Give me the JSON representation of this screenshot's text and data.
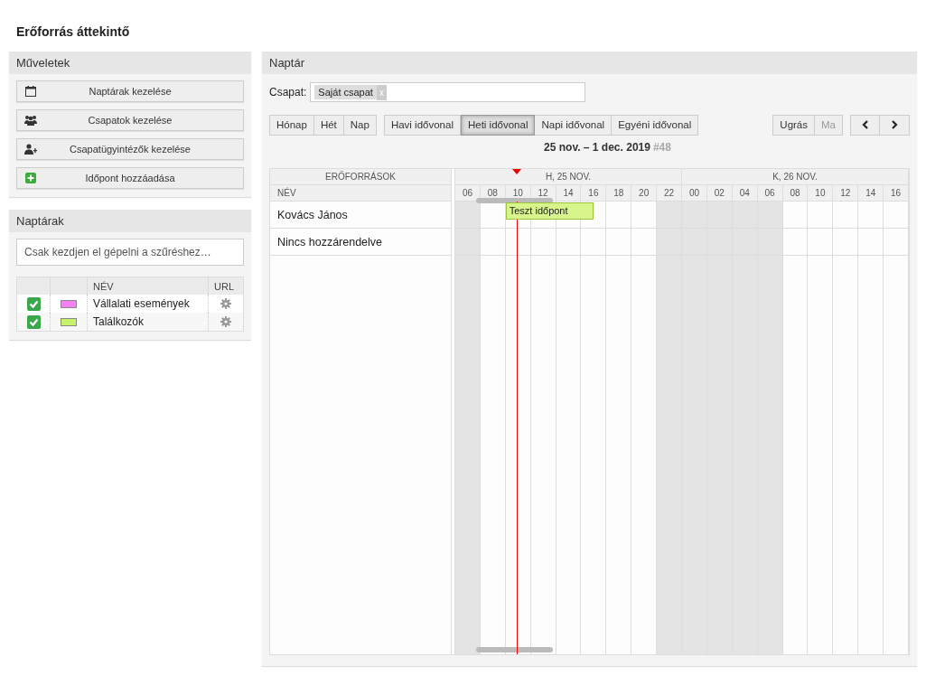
{
  "page_title": "Erőforrás áttekintő",
  "actions": {
    "title": "Műveletek",
    "buttons": [
      {
        "label": "Naptárak kezelése",
        "kind": "calendar"
      },
      {
        "label": "Csapatok kezelése",
        "kind": "group"
      },
      {
        "label": "Csapatügyintézők kezelése",
        "kind": "user-add"
      },
      {
        "label": "Időpont hozzáadása",
        "kind": "add"
      }
    ]
  },
  "calendars": {
    "title": "Naptárak",
    "filter": {
      "placeholder": "Csak kezdjen el gépelni a szűréshez…"
    },
    "columns": [
      "NÉV",
      "URL"
    ],
    "rows": [
      {
        "checked": true,
        "color": "#f380f0",
        "name": "Vállalati események"
      },
      {
        "checked": true,
        "color": "#c8f26b",
        "name": "Találkozók"
      }
    ]
  },
  "calendar": {
    "title": "Naptár",
    "team_label": "Csapat:",
    "team_tags": [
      {
        "label": "Saját csapat",
        "remove": "x"
      }
    ],
    "view_groups": [
      [
        {
          "label": "Hónap",
          "selected": false
        },
        {
          "label": "Hét",
          "selected": false
        },
        {
          "label": "Nap",
          "selected": false
        }
      ],
      [
        {
          "label": "Havi idővonal",
          "selected": false
        },
        {
          "label": "Heti idővonal",
          "selected": true
        },
        {
          "label": "Napi idővonal",
          "selected": false
        },
        {
          "label": "Egyéni idővonal",
          "selected": false
        }
      ]
    ],
    "jump_button": "Ugrás",
    "today_button": {
      "label": "Ma",
      "disabled": true
    },
    "range": "25 nov. – 1 dec. 2019",
    "week": "#48",
    "resources_header": "ERŐFORRÁSOK",
    "name_header": "NÉV",
    "days": [
      {
        "label": "H, 25 NOV.",
        "hours": [
          {
            "label": "06",
            "night": true
          },
          {
            "label": "08",
            "night": false
          },
          {
            "label": "10",
            "night": false,
            "current": true
          },
          {
            "label": "12",
            "night": false
          },
          {
            "label": "14",
            "night": false
          },
          {
            "label": "16",
            "night": false
          },
          {
            "label": "18",
            "night": false
          },
          {
            "label": "20",
            "night": false
          },
          {
            "label": "22",
            "night": true
          }
        ]
      },
      {
        "label": "K, 26 NOV.",
        "hours": [
          {
            "label": "00",
            "night": true
          },
          {
            "label": "02",
            "night": true
          },
          {
            "label": "04",
            "night": true
          },
          {
            "label": "06",
            "night": true
          },
          {
            "label": "08",
            "night": false
          },
          {
            "label": "10",
            "night": false
          },
          {
            "label": "12",
            "night": false
          },
          {
            "label": "14",
            "night": false
          },
          {
            "label": "16",
            "night": false
          }
        ]
      }
    ],
    "resources": [
      {
        "name": "Kovács János",
        "events": [
          {
            "title": "Teszt időpont"
          }
        ]
      },
      {
        "name": "Nincs hozzárendelve"
      }
    ]
  }
}
